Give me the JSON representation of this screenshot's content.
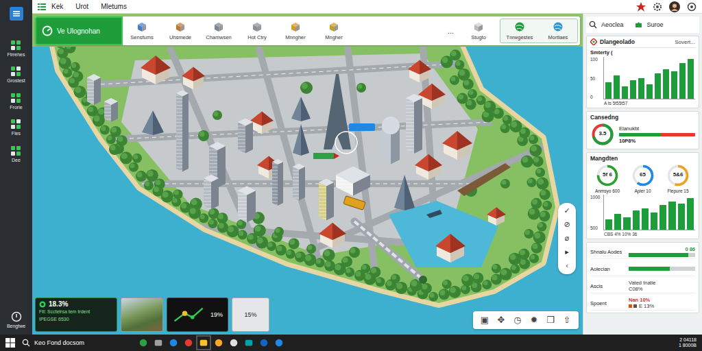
{
  "window": {
    "menu": [
      "Kek",
      "Urot",
      "Mletums"
    ]
  },
  "sidebar": {
    "items": [
      "Ftrrehes",
      "Grostest",
      "Frorie",
      "Fles",
      "Dee"
    ],
    "footer": "Bengtwe"
  },
  "toolbar": {
    "primary": "Ve Ulognohan",
    "items": [
      "Sensfums",
      "Uhsmede",
      "Chamwsen",
      "Hot Ctry",
      "Mnngher",
      "Mngher"
    ],
    "more": "...",
    "end": "Stugto",
    "group": [
      "Tnrwgestes",
      "Mortlaes"
    ]
  },
  "panel": {
    "tabs": [
      "Aeoclea",
      "Suroe"
    ],
    "header": {
      "title": "Dlangeolado",
      "action": "Sovert..."
    },
    "chart": {
      "title": "Smterty (",
      "ticks": [
        "100",
        "50",
        "0"
      ],
      "caption": "A ts 5t55t57",
      "values": [
        40,
        55,
        30,
        45,
        50,
        35,
        60,
        70,
        65,
        85,
        95
      ]
    },
    "gauge": {
      "title": "Cansedng",
      "value": "3.5",
      "level": 0.7,
      "meter": {
        "label": "Elanukbt",
        "level": 0.55,
        "value": "10P8%"
      }
    },
    "metrics": {
      "title": "Mangdten",
      "donuts": [
        {
          "value": "5f 6",
          "label": "Anmsyo 600",
          "level": 0.75,
          "color": "#2e9e2e"
        },
        {
          "value": "65",
          "label": "Apler 10",
          "level": 0.6,
          "color": "#1e88e5"
        },
        {
          "value": "5&6",
          "label": "Flepure 15",
          "level": 0.55,
          "color": "#f0a020"
        }
      ],
      "chart": {
        "ticks": [
          "1000",
          "500"
        ],
        "caption": "CBS 4% 10% 36",
        "values": [
          300,
          450,
          350,
          550,
          600,
          500,
          700,
          800,
          750,
          900
        ]
      }
    },
    "stats": [
      {
        "kind": "bar",
        "label": "Shnalu Aodes",
        "level": 0.9,
        "value": "0 86"
      },
      {
        "kind": "bar",
        "label": "Aolecian",
        "level": 0.62
      },
      {
        "kind": "text",
        "label": "Ascis",
        "value": "Vated tnatie",
        "sub": "C08%"
      },
      {
        "kind": "alert",
        "label": "Spoent",
        "value": "Nan 10%",
        "sub": "E 13%"
      }
    ]
  },
  "map": {
    "tools": [
      "✓",
      "⊘",
      "⌀",
      "▸",
      "‹"
    ],
    "actions": [
      "▣",
      "✥",
      "◷",
      "✹",
      "❒",
      "⇧"
    ]
  },
  "cards": [
    {
      "kind": "stat",
      "value": "18.3%",
      "lines": [
        "Ftt: Scctelrsa tem trdent",
        "IPEGSE 6530"
      ]
    },
    {
      "kind": "photo"
    },
    {
      "kind": "route",
      "value": "19%"
    },
    {
      "kind": "blank",
      "value": "15%"
    }
  ],
  "taskbar": {
    "search": "Keo Fond docsom",
    "clock": [
      "2 04118",
      "1 8000B"
    ]
  }
}
